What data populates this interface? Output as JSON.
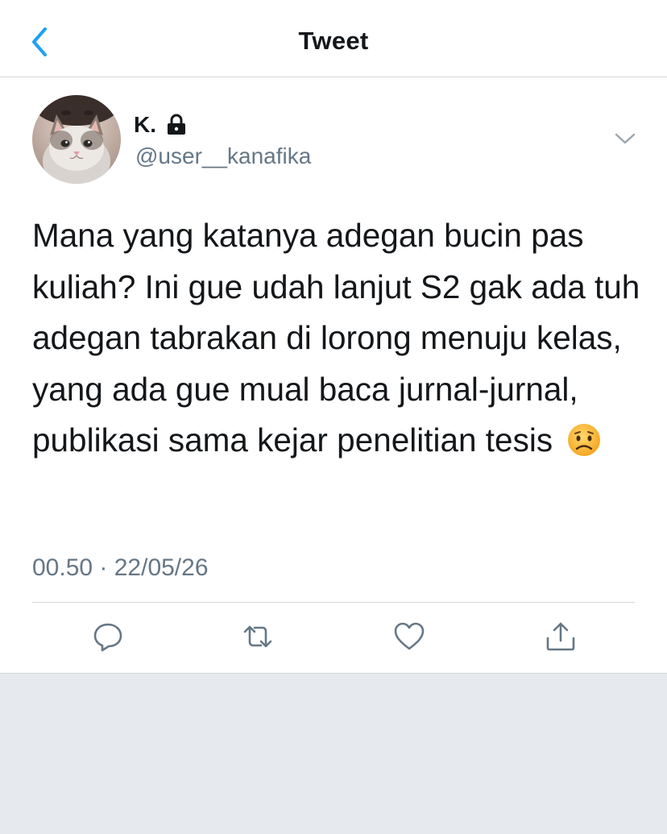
{
  "nav": {
    "title": "Tweet",
    "back_icon": "chevron-left-icon",
    "accent_color": "#1da1f2"
  },
  "tweet": {
    "display_name": "K.",
    "protected_icon": "lock-icon",
    "handle": "@user__kanafika",
    "text": "Mana yang katanya adegan bucin pas kuliah? Ini gue udah lanjut S2 gak ada tuh adegan tabrakan di lorong menuju kelas, yang ada gue mual baca jurnal-jurnal, publikasi sama kejar penelitian tesis",
    "emoji_icon": "worried-face-emoji",
    "timestamp": "00.50 · 22/05/26",
    "more_icon": "chevron-down-icon"
  },
  "actions": [
    {
      "name": "reply",
      "icon": "reply-icon"
    },
    {
      "name": "retweet",
      "icon": "retweet-icon"
    },
    {
      "name": "like",
      "icon": "heart-icon"
    },
    {
      "name": "share",
      "icon": "share-icon"
    }
  ],
  "colors": {
    "text_primary": "#14171a",
    "text_secondary": "#657786",
    "divider": "#d3d8dc",
    "background_below": "#e6e9ee"
  }
}
